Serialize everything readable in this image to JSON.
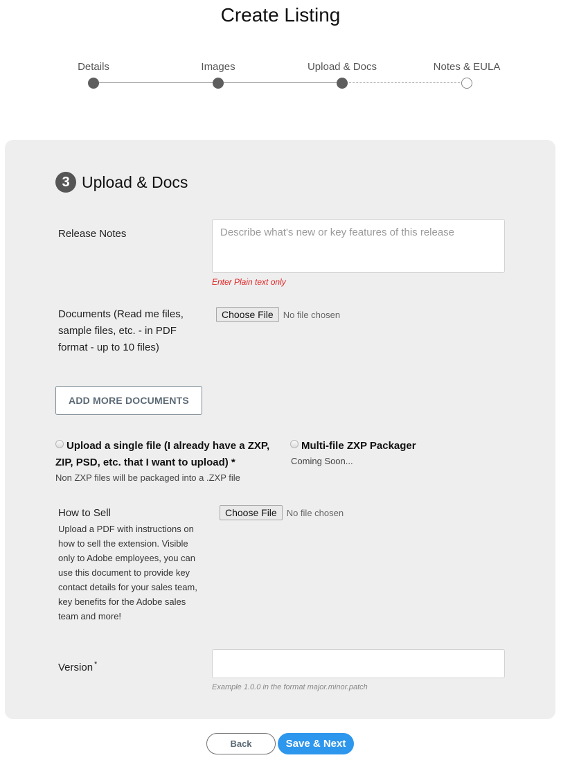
{
  "page": {
    "title": "Create Listing"
  },
  "stepper": {
    "steps": [
      {
        "label": "Details",
        "state": "complete"
      },
      {
        "label": "Images",
        "state": "complete"
      },
      {
        "label": "Upload & Docs",
        "state": "current"
      },
      {
        "label": "Notes & EULA",
        "state": "pending"
      }
    ]
  },
  "section": {
    "number": "3",
    "title": "Upload & Docs"
  },
  "release_notes": {
    "label": "Release Notes",
    "value": "",
    "placeholder": "Describe what's new or key features of this release",
    "hint": "Enter Plain text only"
  },
  "documents": {
    "label": "Documents (Read me files, sample files, etc. - in PDF format - up to 10 files)",
    "button": "Choose File",
    "status": "No file chosen"
  },
  "add_more_documents": {
    "label": "ADD MORE DOCUMENTS"
  },
  "upload_options": [
    {
      "label": "Upload a single file (I already have a ZXP, ZIP, PSD, etc. that I want to upload) *",
      "sub": "Non ZXP files will be packaged into a .ZXP file",
      "selected": false
    },
    {
      "label": "Multi-file ZXP Packager",
      "sub": "Coming Soon...",
      "selected": false
    }
  ],
  "how_to_sell": {
    "label": "How to Sell",
    "description": "Upload a PDF with instructions on how to sell the extension. Visible only to Adobe employees, you can use this document to provide key contact details for your sales team, key benefits for the Adobe sales team and more!",
    "button": "Choose File",
    "status": "No file chosen"
  },
  "version": {
    "label": "Version",
    "required_mark": "*",
    "value": "",
    "hint": "Example 1.0.0 in the format major.minor.patch"
  },
  "footer": {
    "back_label": "Back",
    "next_label": "Save & Next"
  },
  "colors": {
    "primary": "#2d96ed",
    "error": "#e02020",
    "step_active": "#5e5e5e"
  }
}
